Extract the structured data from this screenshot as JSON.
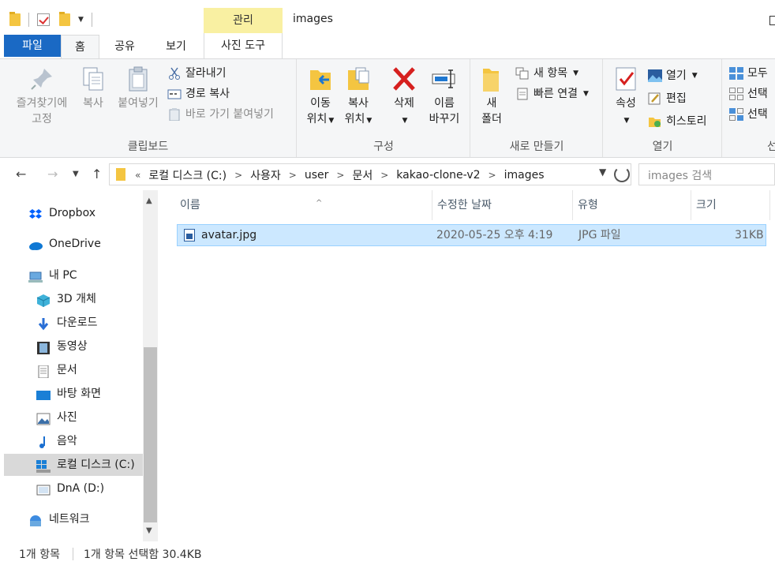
{
  "window": {
    "title": "images",
    "context_tab_group": "관리"
  },
  "ribbon_tabs": [
    "파일",
    "홈",
    "공유",
    "보기",
    "사진 도구"
  ],
  "ribbon": {
    "clipboard": {
      "group_label": "클립보드",
      "pin": "즐겨찾기에\n고정",
      "pin_l1": "즐겨찾기에",
      "pin_l2": "고정",
      "copy": "복사",
      "paste": "붙여넣기",
      "cut": "잘라내기",
      "copy_path": "경로 복사",
      "paste_shortcut": "바로 가기 붙여넣기"
    },
    "organize": {
      "group_label": "구성",
      "move_l1": "이동",
      "move_l2": "위치",
      "copyto_l1": "복사",
      "copyto_l2": "위치",
      "delete": "삭제",
      "rename_l1": "이름",
      "rename_l2": "바꾸기"
    },
    "new": {
      "group_label": "새로 만들기",
      "folder_l1": "새",
      "folder_l2": "폴더",
      "new_item": "새 항목",
      "easy_access": "빠른 연결"
    },
    "open": {
      "group_label": "열기",
      "properties": "속성",
      "open": "열기",
      "edit": "편집",
      "history": "히스토리"
    },
    "select": {
      "all": "모두",
      "none": "선택",
      "invert": "선택",
      "group_label_partial": "선"
    }
  },
  "address": {
    "crumbs": [
      "로컬 디스크 (C:)",
      "사용자",
      "user",
      "문서",
      "kakao-clone-v2",
      "images"
    ],
    "overflow": "«",
    "search_placeholder": "images 검색"
  },
  "nav_pane": [
    {
      "label": "Dropbox",
      "icon": "dropbox-icon"
    },
    {
      "label": "OneDrive",
      "icon": "onedrive-icon"
    },
    {
      "label": "내 PC",
      "icon": "pc-icon"
    },
    {
      "label": "3D 개체",
      "icon": "3d-objects-icon"
    },
    {
      "label": "다운로드",
      "icon": "download-icon"
    },
    {
      "label": "동영상",
      "icon": "video-icon"
    },
    {
      "label": "문서",
      "icon": "document-icon"
    },
    {
      "label": "바탕 화면",
      "icon": "desktop-icon"
    },
    {
      "label": "사진",
      "icon": "pictures-icon"
    },
    {
      "label": "음악",
      "icon": "music-icon"
    },
    {
      "label": "로컬 디스크 (C:)",
      "icon": "local-disk-icon"
    },
    {
      "label": "DnA (D:)",
      "icon": "drive-icon"
    },
    {
      "label": "네트워크",
      "icon": "network-icon"
    }
  ],
  "columns": [
    "이름",
    "수정한 날짜",
    "유형",
    "크기"
  ],
  "files": [
    {
      "name": "avatar.jpg",
      "modified": "2020-05-25 오후 4:19",
      "type": "JPG 파일",
      "size": "31KB"
    }
  ],
  "status": {
    "count": "1개 항목",
    "selection": "1개 항목 선택함 30.4KB"
  },
  "colors": {
    "file_tab": "#1a69c4",
    "context_tab": "#f9f0a2",
    "selection": "#cce8ff",
    "nav_selected": "#d9d9d9"
  }
}
